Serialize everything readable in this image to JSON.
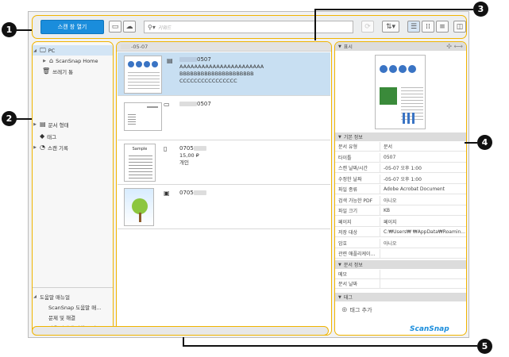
{
  "toolbar": {
    "scan_button": "스캔 창 열기",
    "search_placeholder": "키워드"
  },
  "tree": {
    "pc": "PC",
    "scansnap_home": "ScanSnap Home",
    "trash": "쓰레기 통",
    "doc_type": "문서 형태",
    "tag": "태그",
    "scan_history": "스캔 기록"
  },
  "help": {
    "header": "도움말 매뉴얼",
    "items": [
      "ScanSnap 도움말 매…",
      "문제 및 해결",
      "사용 방법에 관한 문의"
    ]
  },
  "list": {
    "date_header": "-05-07",
    "items": [
      {
        "title": "0507",
        "line1": "AAAAAAAAAAAAAAAAAAAAAAA",
        "line2": "BBBBBBBBBBBBBBBBBBBBB",
        "line3": "CCCCCCCCCCCCCCCC"
      },
      {
        "title": "0507"
      },
      {
        "title": "0705",
        "line1": "15,00 ₽",
        "line2": "개인"
      },
      {
        "title": "0705"
      }
    ]
  },
  "props": {
    "display_header": "표시",
    "basic_header": "기본 정보",
    "rows": [
      {
        "k": "문서 유형",
        "v": "문서"
      },
      {
        "k": "타이틀",
        "v": "0507"
      },
      {
        "k": "스캔 날짜/시간",
        "v": "-05-07 오후 1:00"
      },
      {
        "k": "수정한 날짜",
        "v": "-05-07 오후 1:00"
      },
      {
        "k": "파일 종류",
        "v": "Adobe Acrobat Document"
      },
      {
        "k": "검색 가능한 PDF",
        "v": "아니오"
      },
      {
        "k": "파일 크기",
        "v": "KB"
      },
      {
        "k": "페이지",
        "v": "페이지"
      },
      {
        "k": "저장 대상",
        "v": "C:₩Users₩ ₩AppData₩Roamin..."
      },
      {
        "k": "암호",
        "v": "아니오"
      },
      {
        "k": "관련 애플리케이…",
        "v": ""
      }
    ],
    "doc_info_header": "문서 정보",
    "doc_rows": [
      {
        "k": "메모",
        "v": ""
      },
      {
        "k": "문서 날짜",
        "v": ""
      }
    ],
    "tag_header": "태그",
    "add_tag": "태그 추가"
  },
  "brand": "ScanSnap",
  "callouts": [
    "1",
    "2",
    "3",
    "4",
    "5"
  ]
}
